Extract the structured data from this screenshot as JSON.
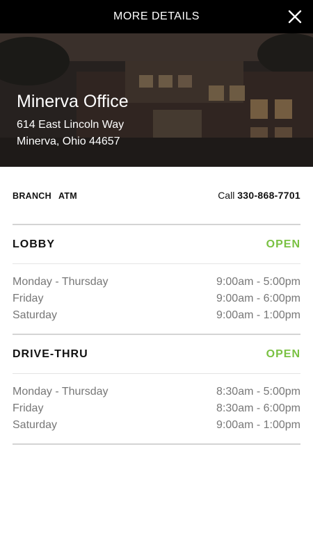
{
  "header": {
    "title": "MORE DETAILS",
    "close_icon": "close-icon"
  },
  "office": {
    "name": "Minerva Office",
    "address_line1": "614 East Lincoln Way",
    "address_line2": "Minerva, Ohio 44657"
  },
  "tabs": [
    {
      "label": "BRANCH"
    },
    {
      "label": "ATM"
    }
  ],
  "call": {
    "label": "Call",
    "phone": "330-868-7701"
  },
  "colors": {
    "open": "#7ac143",
    "topbar": "#000000"
  },
  "lobby": {
    "title": "LOBBY",
    "status": "OPEN",
    "hours": [
      {
        "day": "Monday - Thursday",
        "time": "9:00am - 5:00pm"
      },
      {
        "day": "Friday",
        "time": "9:00am - 6:00pm"
      },
      {
        "day": "Saturday",
        "time": "9:00am - 1:00pm"
      }
    ]
  },
  "drivethru": {
    "title": "DRIVE-THRU",
    "status": "OPEN",
    "hours": [
      {
        "day": "Monday - Thursday",
        "time": "8:30am - 5:00pm"
      },
      {
        "day": "Friday",
        "time": "8:30am - 6:00pm"
      },
      {
        "day": "Saturday",
        "time": "9:00am - 1:00pm"
      }
    ]
  }
}
